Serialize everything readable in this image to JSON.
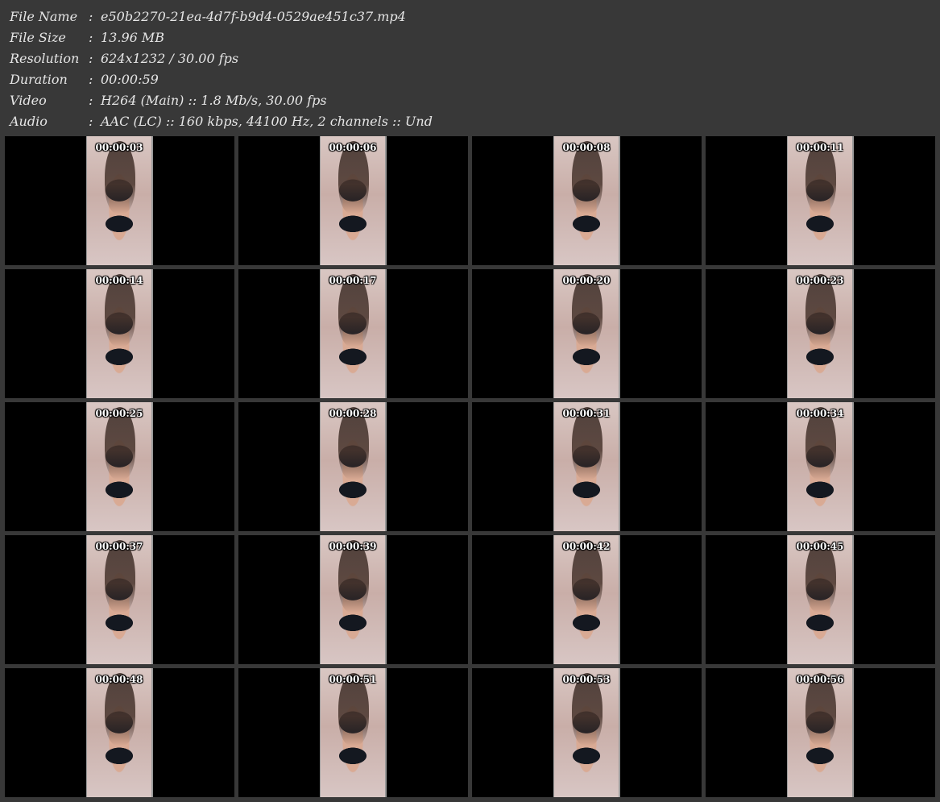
{
  "info": [
    {
      "key": "File Name",
      "sep": ":",
      "value": "e50b2270-21ea-4d7f-b9d4-0529ae451c37.mp4"
    },
    {
      "key": "File Size",
      "sep": ":",
      "value": "13.96 MB"
    },
    {
      "key": "Resolution",
      "sep": ":",
      "value": "624x1232 / 30.00 fps"
    },
    {
      "key": "Duration",
      "sep": ":",
      "value": "00:00:59"
    },
    {
      "key": "Video",
      "sep": ":",
      "value": "H264 (Main) :: 1.8 Mb/s, 30.00 fps"
    },
    {
      "key": "Audio",
      "sep": ":",
      "value": "AAC (LC) :: 160 kbps, 44100 Hz, 2 channels :: Und"
    }
  ],
  "thumbnails": [
    "00:00:03",
    "00:00:06",
    "00:00:08",
    "00:00:11",
    "00:00:14",
    "00:00:17",
    "00:00:20",
    "00:00:23",
    "00:00:25",
    "00:00:28",
    "00:00:31",
    "00:00:34",
    "00:00:37",
    "00:00:39",
    "00:00:42",
    "00:00:45",
    "00:00:48",
    "00:00:51",
    "00:00:53",
    "00:00:56"
  ]
}
